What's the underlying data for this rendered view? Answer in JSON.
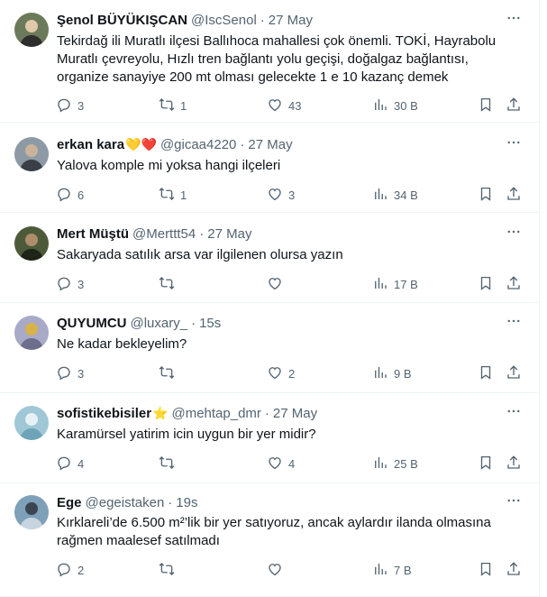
{
  "tweets": [
    {
      "name": "Şenol BÜYÜKIŞCAN",
      "name_emoji": "",
      "handle": "@IscSenol",
      "time": "27 May",
      "text_lines": [
        "Tekirdağ ili Muratlı ilçesi Ballıhoca mahallesi çok önemli. TOKİ, Hayrabolu",
        "Muratlı çevreyolu, Hızlı tren bağlantı yolu geçişi, doğalgaz bağlantısı,",
        "organize sanayiye 200 mt olması gelecekte 1 e 10 kazanç demek"
      ],
      "replies": "3",
      "reposts": "1",
      "likes": "43",
      "views": "30 B",
      "avatar_colors": [
        "#6b7a5a",
        "#e0c9a8",
        "#2d2d2d"
      ]
    },
    {
      "name": "erkan kara",
      "name_emoji": "💛❤️",
      "handle": "@gicaa4220",
      "time": "27 May",
      "text_lines": [
        "Yalova komple mi yoksa hangi ilçeleri"
      ],
      "replies": "6",
      "reposts": "1",
      "likes": "3",
      "views": "34 B",
      "avatar_colors": [
        "#8d9aa6",
        "#c9b39a",
        "#3a3f45"
      ]
    },
    {
      "name": "Mert Müştü",
      "name_emoji": "",
      "handle": "@Merttt54",
      "time": "27 May",
      "text_lines": [
        "Sakaryada satılık arsa var ilgilenen olursa yazın"
      ],
      "replies": "3",
      "reposts": "",
      "likes": "",
      "views": "17 B",
      "avatar_colors": [
        "#4d5a3a",
        "#b08d6a",
        "#1e2418"
      ]
    },
    {
      "name": "QUYUMCU",
      "name_emoji": "",
      "handle": "@luxary_",
      "time": "15s",
      "text_lines": [
        "Ne kadar bekleyelim?"
      ],
      "replies": "3",
      "reposts": "",
      "likes": "2",
      "views": "9 B",
      "avatar_colors": [
        "#a9a9c8",
        "#d8b24a",
        "#6d6d8c"
      ]
    },
    {
      "name": "sofistikebisiler",
      "name_emoji": "⭐",
      "handle": "@mehtap_dmr",
      "time": "27 May",
      "text_lines": [
        "Karamürsel yatirim icin uygun bir yer midir?"
      ],
      "replies": "4",
      "reposts": "",
      "likes": "4",
      "views": "25 B",
      "avatar_colors": [
        "#9fc7d6",
        "#e6f1f5",
        "#6fa4b8"
      ]
    },
    {
      "name": "Ege",
      "name_emoji": "",
      "handle": "@egeistaken",
      "time": "19s",
      "text_lines": [
        "Kırklareli’de 6.500 m²’lik bir yer satıyoruz, ancak aylardır ilanda olmasına",
        "rağmen maalesef satılmadı"
      ],
      "replies": "2",
      "reposts": "",
      "likes": "",
      "views": "7 B",
      "avatar_colors": [
        "#7ea0b8",
        "#3b4450",
        "#c7d5e0"
      ]
    }
  ],
  "separator": "·",
  "colors": {
    "text": "#0f1419",
    "secondary": "#536471",
    "border": "#eff3f4"
  },
  "icons": [
    "more-icon",
    "reply-icon",
    "repost-icon",
    "like-icon",
    "views-icon",
    "bookmark-icon",
    "share-icon"
  ]
}
